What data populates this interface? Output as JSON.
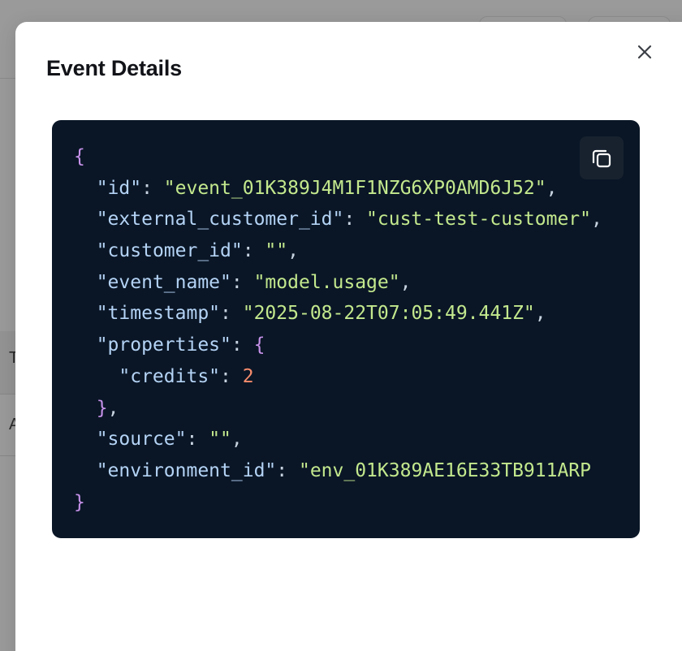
{
  "modal": {
    "title": "Event Details",
    "close_icon": "close-icon",
    "copy_icon": "copy-icon"
  },
  "background": {
    "glyph_1": "T",
    "glyph_2": "A"
  },
  "colors": {
    "code_background": "#0a1626",
    "brace": "#c792ea",
    "key": "#b4d3f5",
    "string": "#c3e88d",
    "number": "#f78c6c"
  },
  "event_json": {
    "open_brace": "{",
    "close_brace": "}",
    "id_key": "\"id\"",
    "id_value": "\"event_01K389J4M1F1NZG6XP0AMD6J52\"",
    "external_customer_id_key": "\"external_customer_id\"",
    "external_customer_id_value": "\"cust-test-customer\"",
    "customer_id_key": "\"customer_id\"",
    "customer_id_value": "\"\"",
    "event_name_key": "\"event_name\"",
    "event_name_value": "\"model.usage\"",
    "timestamp_key": "\"timestamp\"",
    "timestamp_value": "\"2025-08-22T07:05:49.441Z\"",
    "properties_key": "\"properties\"",
    "properties_open": "{",
    "credits_key": "\"credits\"",
    "credits_value": "2",
    "properties_close": "}",
    "source_key": "\"source\"",
    "source_value": "\"\"",
    "environment_id_key": "\"environment_id\"",
    "environment_id_value": "\"env_01K389AE16E33TB911ARP"
  }
}
